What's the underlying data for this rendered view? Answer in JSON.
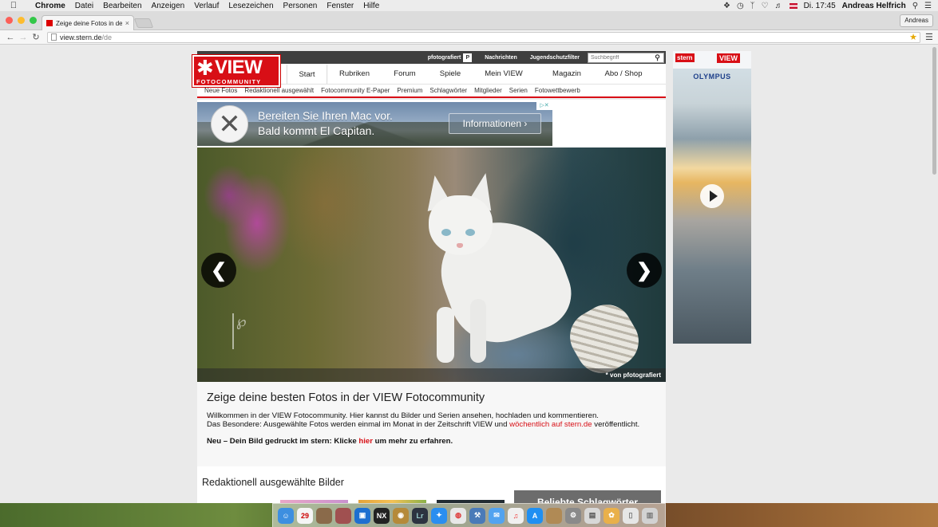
{
  "menubar": {
    "app": "Chrome",
    "menus": [
      "Datei",
      "Bearbeiten",
      "Anzeigen",
      "Verlauf",
      "Lesezeichen",
      "Personen",
      "Fenster",
      "Hilfe"
    ],
    "clock": "Di. 17:45",
    "user": "Andreas Helfrich"
  },
  "browser": {
    "tab_title": "Zeige deine Fotos in der VIEW",
    "profile": "Andreas",
    "url_host": "view.stern.de",
    "url_path": "/de"
  },
  "site": {
    "logo": {
      "word": "VIEW",
      "sub": "FOTOCOMMUNITY"
    },
    "topbar": {
      "links": [
        "pfotografiert",
        "Nachrichten",
        "Jugendschutzfilter"
      ],
      "search_placeholder": "Suchbegriff"
    },
    "mainnav": [
      "Start",
      "Rubriken",
      "Forum",
      "Spiele",
      "Mein VIEW",
      "Magazin",
      "Abo / Shop"
    ],
    "subnav": [
      "Neue Fotos",
      "Redaktionell ausgewählt",
      "Fotocommunity E-Paper",
      "Premium",
      "Schlagwörter",
      "Mitglieder",
      "Serien",
      "Fotowettbewerb"
    ],
    "banner": {
      "line1": "Bereiten Sie Ihren Mac vor.",
      "line2": "Bald kommt El Capitan.",
      "cta": "Informationen ›"
    },
    "hero": {
      "credit": "* von pfotografiert"
    },
    "intro": {
      "title": "Zeige deine besten Fotos in der VIEW Fotocommunity",
      "p1": "Willkommen in der VIEW Fotocommunity. Hier kannst du Bilder und Serien ansehen, hochladen und kommentieren.",
      "p2_start": "Das Besondere: Ausgewählte Fotos werden einmal im Monat in der Zeitschrift VIEW und ",
      "p2_link": "wöchentlich auf stern.de",
      "p2_end": " veröffentlicht.",
      "cta_start": "Neu – Dein Bild gedruckt im stern: Klicke ",
      "cta_link": "hier",
      "cta_end": " um mehr zu erfahren."
    },
    "lower": {
      "section_title": "Redaktionell ausgewählte Bilder",
      "tags_title": "Beliebte Schlagwörter"
    }
  },
  "sky_ad": {
    "brand1": "stern",
    "brand2": "VIEW",
    "sponsor": "OLYMPUS"
  },
  "colors": {
    "brand_red": "#d80f16",
    "topbar": "#3f3f3f"
  }
}
